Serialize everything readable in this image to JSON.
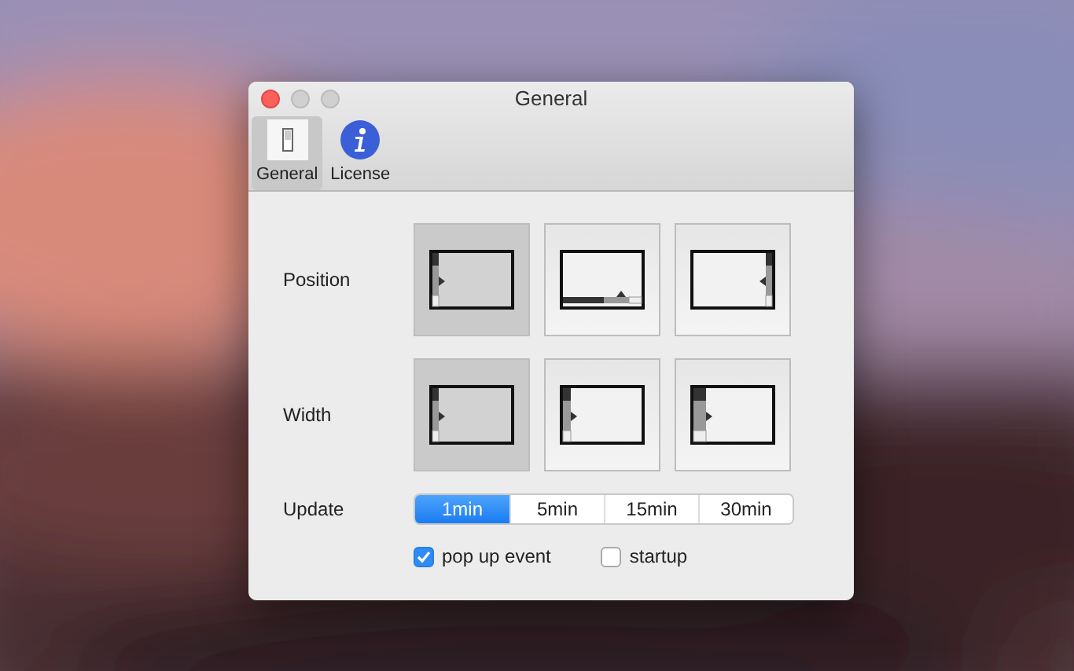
{
  "window": {
    "title": "General"
  },
  "toolbar": [
    {
      "label": "General",
      "kind": "switch",
      "selected": true
    },
    {
      "label": "License",
      "kind": "info",
      "selected": false
    }
  ],
  "settings": [
    {
      "label": "Position",
      "options": [
        {
          "kind": "left",
          "selected": true
        },
        {
          "kind": "bottom",
          "selected": false
        },
        {
          "kind": "right",
          "selected": false
        }
      ]
    },
    {
      "label": "Width",
      "options": [
        {
          "kind": "narrow",
          "selected": true
        },
        {
          "kind": "medium",
          "selected": false
        },
        {
          "kind": "wide",
          "selected": false
        }
      ]
    }
  ],
  "update": {
    "label": "Update",
    "segments": [
      {
        "label": "1min",
        "selected": true
      },
      {
        "label": "5min",
        "selected": false
      },
      {
        "label": "15min",
        "selected": false
      },
      {
        "label": "30min",
        "selected": false
      }
    ]
  },
  "checkboxes": [
    {
      "label": "pop up event",
      "checked": true
    },
    {
      "label": "startup",
      "checked": false
    }
  ]
}
